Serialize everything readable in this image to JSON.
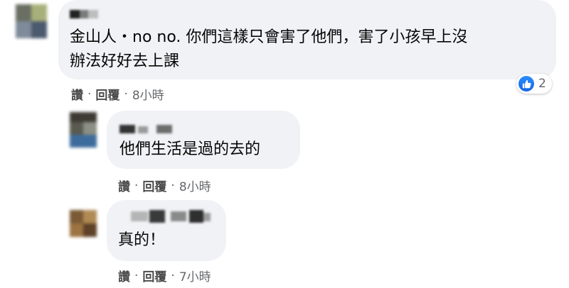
{
  "comments": [
    {
      "text": "金山人・no no. 你們這樣只會害了他們，害了小孩早上沒\n辦法好好去上課",
      "actions": {
        "read": "讚",
        "reply": "回覆",
        "time": "8小時"
      },
      "reaction": {
        "icon": "like-icon",
        "count": "2"
      }
    },
    {
      "text": "他們生活是過的去的",
      "actions": {
        "read": "讚",
        "reply": "回覆",
        "time": "8小時"
      }
    },
    {
      "text": "真的！",
      "actions": {
        "read": "讚",
        "reply": "回覆",
        "time": "7小時"
      }
    }
  ],
  "colors": {
    "bubble": "#f0f2f5",
    "like_blue": "#1877f2",
    "meta_gray": "#65676b"
  }
}
